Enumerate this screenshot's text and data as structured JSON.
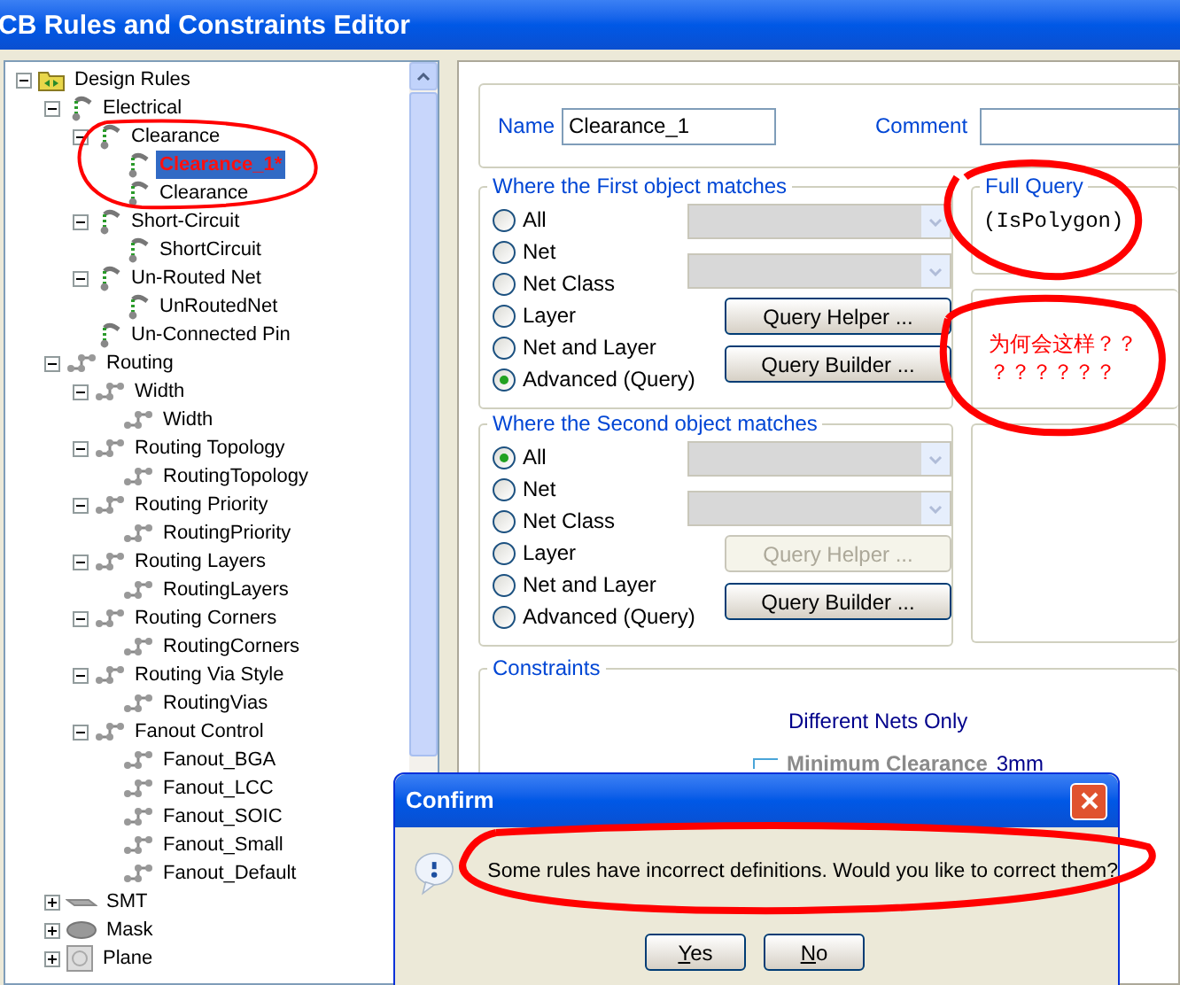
{
  "window": {
    "title": "CB Rules and Constraints Editor"
  },
  "tree": [
    {
      "label": "Design Rules",
      "kind": "folder",
      "expanded": true,
      "selected": false,
      "invalid": false,
      "children": [
        {
          "label": "Electrical",
          "kind": "electrical",
          "expanded": true,
          "selected": false,
          "invalid": false,
          "children": [
            {
              "label": "Clearance",
              "kind": "electrical",
              "expanded": true,
              "selected": false,
              "invalid": false,
              "children": [
                {
                  "label": "Clearance_1*",
                  "kind": "electrical",
                  "selected": true,
                  "invalid": true
                },
                {
                  "label": "Clearance",
                  "kind": "electrical",
                  "selected": false,
                  "invalid": false
                }
              ]
            },
            {
              "label": "Short-Circuit",
              "kind": "electrical",
              "expanded": true,
              "selected": false,
              "invalid": false,
              "children": [
                {
                  "label": "ShortCircuit",
                  "kind": "electrical",
                  "selected": false,
                  "invalid": false
                }
              ]
            },
            {
              "label": "Un-Routed Net",
              "kind": "electrical",
              "expanded": true,
              "selected": false,
              "invalid": false,
              "children": [
                {
                  "label": "UnRoutedNet",
                  "kind": "electrical",
                  "selected": false,
                  "invalid": false
                }
              ]
            },
            {
              "label": "Un-Connected Pin",
              "kind": "electrical",
              "selected": false,
              "invalid": false
            }
          ]
        },
        {
          "label": "Routing",
          "kind": "routing",
          "expanded": true,
          "selected": false,
          "invalid": false,
          "children": [
            {
              "label": "Width",
              "kind": "routing",
              "expanded": true,
              "selected": false,
              "invalid": false,
              "children": [
                {
                  "label": "Width",
                  "kind": "routing",
                  "selected": false,
                  "invalid": false
                }
              ]
            },
            {
              "label": "Routing Topology",
              "kind": "routing",
              "expanded": true,
              "selected": false,
              "invalid": false,
              "children": [
                {
                  "label": "RoutingTopology",
                  "kind": "routing",
                  "selected": false,
                  "invalid": false
                }
              ]
            },
            {
              "label": "Routing Priority",
              "kind": "routing",
              "expanded": true,
              "selected": false,
              "invalid": false,
              "children": [
                {
                  "label": "RoutingPriority",
                  "kind": "routing",
                  "selected": false,
                  "invalid": false
                }
              ]
            },
            {
              "label": "Routing Layers",
              "kind": "routing",
              "expanded": true,
              "selected": false,
              "invalid": false,
              "children": [
                {
                  "label": "RoutingLayers",
                  "kind": "routing",
                  "selected": false,
                  "invalid": false
                }
              ]
            },
            {
              "label": "Routing Corners",
              "kind": "routing",
              "expanded": true,
              "selected": false,
              "invalid": false,
              "children": [
                {
                  "label": "RoutingCorners",
                  "kind": "routing",
                  "selected": false,
                  "invalid": false
                }
              ]
            },
            {
              "label": "Routing Via Style",
              "kind": "routing",
              "expanded": true,
              "selected": false,
              "invalid": false,
              "children": [
                {
                  "label": "RoutingVias",
                  "kind": "routing",
                  "selected": false,
                  "invalid": false
                }
              ]
            },
            {
              "label": "Fanout Control",
              "kind": "routing",
              "expanded": true,
              "selected": false,
              "invalid": false,
              "children": [
                {
                  "label": "Fanout_BGA",
                  "kind": "routing",
                  "selected": false,
                  "invalid": false
                },
                {
                  "label": "Fanout_LCC",
                  "kind": "routing",
                  "selected": false,
                  "invalid": false
                },
                {
                  "label": "Fanout_SOIC",
                  "kind": "routing",
                  "selected": false,
                  "invalid": false
                },
                {
                  "label": "Fanout_Small",
                  "kind": "routing",
                  "selected": false,
                  "invalid": false
                },
                {
                  "label": "Fanout_Default",
                  "kind": "routing",
                  "selected": false,
                  "invalid": false
                }
              ]
            }
          ]
        },
        {
          "label": "SMT",
          "kind": "smt",
          "expanded": false,
          "selected": false,
          "invalid": false
        },
        {
          "label": "Mask",
          "kind": "mask",
          "expanded": false,
          "selected": false,
          "invalid": false
        },
        {
          "label": "Plane",
          "kind": "plane",
          "expanded": false,
          "selected": false,
          "invalid": false
        }
      ]
    }
  ],
  "name_row": {
    "name_label": "Name",
    "name_value": "Clearance_1",
    "comment_label": "Comment"
  },
  "first_object": {
    "title": "Where the First object matches",
    "options": [
      {
        "label": "All",
        "selected": false
      },
      {
        "label": "Net",
        "selected": false
      },
      {
        "label": "Net Class",
        "selected": false
      },
      {
        "label": "Layer",
        "selected": false
      },
      {
        "label": "Net and Layer",
        "selected": false
      },
      {
        "label": "Advanced (Query)",
        "selected": true
      }
    ],
    "query_helper": {
      "label": "Query Helper ...",
      "disabled": false
    },
    "query_builder": {
      "label": "Query Builder ...",
      "disabled": false
    }
  },
  "full_query": {
    "title": "Full Query",
    "text": "(IsPolygon)"
  },
  "second_object": {
    "title": "Where the Second object matches",
    "options": [
      {
        "label": "All",
        "selected": true
      },
      {
        "label": "Net",
        "selected": false
      },
      {
        "label": "Net Class",
        "selected": false
      },
      {
        "label": "Layer",
        "selected": false
      },
      {
        "label": "Net and Layer",
        "selected": false
      },
      {
        "label": "Advanced (Query)",
        "selected": false
      }
    ],
    "query_helper": {
      "label": "Query Helper ...",
      "disabled": true
    },
    "query_builder": {
      "label": "Query Builder ...",
      "disabled": false
    }
  },
  "constraints": {
    "title": "Constraints",
    "mode": "Different Nets Only",
    "min_label": "Minimum Clearance",
    "min_value": "3mm"
  },
  "annotation": {
    "text": "为何会这样？？？？？？？？"
  },
  "dialog": {
    "title": "Confirm",
    "message": "Some rules have incorrect definitions. Would you like to correct them?",
    "buttons": [
      {
        "mnemonic": "Y",
        "rest": "es"
      },
      {
        "mnemonic": "N",
        "rest": "o"
      }
    ]
  }
}
